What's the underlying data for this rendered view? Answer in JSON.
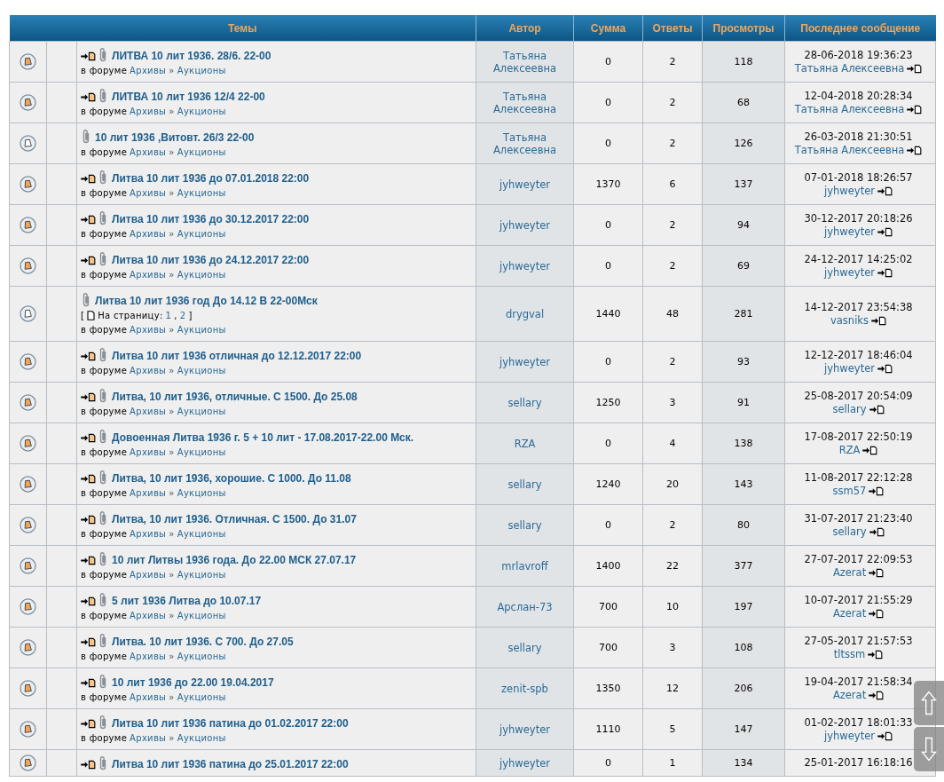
{
  "table": {
    "columns": [
      "Темы",
      "Автор",
      "Сумма",
      "Ответы",
      "Просмотры",
      "Последнее сообщение"
    ],
    "rows": [
      {
        "title": "ЛИТВА 10 лит 1936. 28/6. 22-00",
        "new_posts": true,
        "forum": {
          "label": "в форуме",
          "path": [
            "Архивы",
            "Аукционы"
          ],
          "separator": "»"
        },
        "author": "Татьяна Алексеевна",
        "sum": "0",
        "replies": "2",
        "views": "118",
        "last_date": "28-06-2018 19:36:23",
        "last_author": "Татьяна Алексеевна"
      },
      {
        "title": "ЛИТВА 10 лит 1936 12/4 22-00",
        "new_posts": true,
        "forum": {
          "label": "в форуме",
          "path": [
            "Архивы",
            "Аукционы"
          ],
          "separator": "»"
        },
        "author": "Татьяна Алексеевна",
        "sum": "0",
        "replies": "2",
        "views": "68",
        "last_date": "12-04-2018 20:28:34",
        "last_author": "Татьяна Алексеевна"
      },
      {
        "title": "10 лит 1936 ,Витовт. 26/3 22-00",
        "new_posts": false,
        "forum": {
          "label": "в форуме",
          "path": [
            "Архивы",
            "Аукционы"
          ],
          "separator": "»"
        },
        "author": "Татьяна Алексеевна",
        "sum": "0",
        "replies": "2",
        "views": "126",
        "last_date": "26-03-2018 21:30:51",
        "last_author": "Татьяна Алексеевна"
      },
      {
        "title": "Литва 10 лит 1936 до 07.01.2018 22:00",
        "new_posts": true,
        "forum": {
          "label": "в форуме",
          "path": [
            "Архивы",
            "Аукционы"
          ],
          "separator": "»"
        },
        "author": "jyhweyter",
        "sum": "1370",
        "replies": "6",
        "views": "137",
        "last_date": "07-01-2018 18:26:57",
        "last_author": "jyhweyter"
      },
      {
        "title": "Литва 10 лит 1936 до 30.12.2017 22:00",
        "new_posts": true,
        "forum": {
          "label": "в форуме",
          "path": [
            "Архивы",
            "Аукционы"
          ],
          "separator": "»"
        },
        "author": "jyhweyter",
        "sum": "0",
        "replies": "2",
        "views": "94",
        "last_date": "30-12-2017 20:18:26",
        "last_author": "jyhweyter"
      },
      {
        "title": "Литва 10 лит 1936 до 24.12.2017 22:00",
        "new_posts": true,
        "forum": {
          "label": "в форуме",
          "path": [
            "Архивы",
            "Аукционы"
          ],
          "separator": "»"
        },
        "author": "jyhweyter",
        "sum": "0",
        "replies": "2",
        "views": "69",
        "last_date": "24-12-2017 14:25:02",
        "last_author": "jyhweyter"
      },
      {
        "title": "Литва 10 лит 1936 год До 14.12 В 22-00Мск",
        "new_posts": false,
        "pages": {
          "open": "[",
          "label": "На страницу:",
          "links": [
            "1",
            "2"
          ],
          "separator": ",",
          "close": "]"
        },
        "forum": {
          "label": "в форуме",
          "path": [
            "Архивы",
            "Аукционы"
          ],
          "separator": "»"
        },
        "author": "drygval",
        "sum": "1440",
        "replies": "48",
        "views": "281",
        "last_date": "14-12-2017 23:54:38",
        "last_author": "vasniks"
      },
      {
        "title": "Литва 10 лит 1936 отличная до 12.12.2017 22:00",
        "new_posts": true,
        "forum": {
          "label": "в форуме",
          "path": [
            "Архивы",
            "Аукционы"
          ],
          "separator": "»"
        },
        "author": "jyhweyter",
        "sum": "0",
        "replies": "2",
        "views": "93",
        "last_date": "12-12-2017 18:46:04",
        "last_author": "jyhweyter"
      },
      {
        "title": "Литва, 10 лит 1936, отличные. С 1500. До 25.08",
        "new_posts": true,
        "forum": {
          "label": "в форуме",
          "path": [
            "Архивы",
            "Аукционы"
          ],
          "separator": "»"
        },
        "author": "sellary",
        "sum": "1250",
        "replies": "3",
        "views": "91",
        "last_date": "25-08-2017 20:54:09",
        "last_author": "sellary"
      },
      {
        "title": "Довоенная Литва 1936 г. 5 + 10 лит - 17.08.2017-22.00 Мск.",
        "new_posts": true,
        "forum": {
          "label": "в форуме",
          "path": [
            "Архивы",
            "Аукционы"
          ],
          "separator": "»"
        },
        "author": "RZA",
        "sum": "0",
        "replies": "4",
        "views": "138",
        "last_date": "17-08-2017 22:50:19",
        "last_author": "RZA"
      },
      {
        "title": "Литва, 10 лит 1936, хорошие. С 1000. До 11.08",
        "new_posts": true,
        "forum": {
          "label": "в форуме",
          "path": [
            "Архивы",
            "Аукционы"
          ],
          "separator": "»"
        },
        "author": "sellary",
        "sum": "1240",
        "replies": "20",
        "views": "143",
        "last_date": "11-08-2017 22:12:28",
        "last_author": "ssm57"
      },
      {
        "title": "Литва, 10 лит 1936. Отличная. С 1500. До 31.07",
        "new_posts": true,
        "forum": {
          "label": "в форуме",
          "path": [
            "Архивы",
            "Аукционы"
          ],
          "separator": "»"
        },
        "author": "sellary",
        "sum": "0",
        "replies": "2",
        "views": "80",
        "last_date": "31-07-2017 21:23:40",
        "last_author": "sellary"
      },
      {
        "title": "10 лит Литвы 1936 года. До 22.00 МСК 27.07.17",
        "new_posts": true,
        "forum": {
          "label": "в форуме",
          "path": [
            "Архивы",
            "Аукционы"
          ],
          "separator": "»"
        },
        "author": "mrlavroff",
        "sum": "1400",
        "replies": "22",
        "views": "377",
        "last_date": "27-07-2017 22:09:53",
        "last_author": "Azerat"
      },
      {
        "title": "5 лит 1936 Литва до 10.07.17",
        "new_posts": true,
        "forum": {
          "label": "в форуме",
          "path": [
            "Архивы",
            "Аукционы"
          ],
          "separator": "»"
        },
        "author": "Арслан-73",
        "sum": "700",
        "replies": "10",
        "views": "197",
        "last_date": "10-07-2017 21:55:29",
        "last_author": "Azerat"
      },
      {
        "title": "Литва. 10 лит 1936. С 700. До 27.05",
        "new_posts": true,
        "forum": {
          "label": "в форуме",
          "path": [
            "Архивы",
            "Аукционы"
          ],
          "separator": "»"
        },
        "author": "sellary",
        "sum": "700",
        "replies": "3",
        "views": "108",
        "last_date": "27-05-2017 21:57:53",
        "last_author": "tltssm"
      },
      {
        "title": "10 лит 1936 до 22.00 19.04.2017",
        "new_posts": true,
        "forum": {
          "label": "в форуме",
          "path": [
            "Архивы",
            "Аукционы"
          ],
          "separator": "»"
        },
        "author": "zenit-spb",
        "sum": "1350",
        "replies": "12",
        "views": "206",
        "last_date": "19-04-2017 21:58:34",
        "last_author": "Azerat"
      },
      {
        "title": "Литва 10 лит 1936 патина до 01.02.2017 22:00",
        "new_posts": true,
        "forum": {
          "label": "в форуме",
          "path": [
            "Архивы",
            "Аукционы"
          ],
          "separator": "»"
        },
        "author": "jyhweyter",
        "sum": "1110",
        "replies": "5",
        "views": "147",
        "last_date": "01-02-2017 18:01:33",
        "last_author": "jyhweyter"
      },
      {
        "title": "Литва 10 лит 1936 патина до 25.01.2017 22:00",
        "new_posts": true,
        "author": "jyhweyter",
        "sum": "0",
        "replies": "1",
        "views": "134",
        "last_date": "25-01-2017 16:18:16"
      }
    ]
  }
}
